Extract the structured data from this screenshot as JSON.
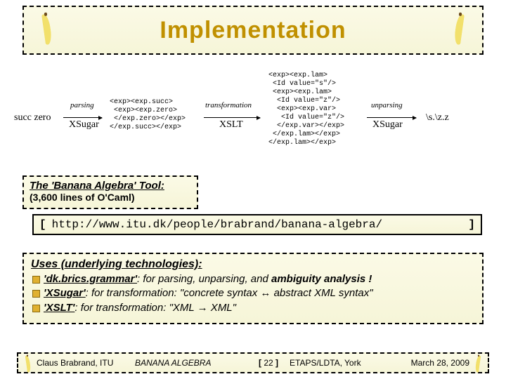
{
  "title": "Implementation",
  "diagram": {
    "source": "succ zero",
    "parsing": "parsing",
    "tool1": "XSugar",
    "xml1": "<exp><exp.succ>\n <exp><exp.zero>\n </exp.zero></exp>\n</exp.succ></exp>",
    "transformation": "transformation",
    "tool2": "XSLT",
    "xml2": "<exp><exp.lam>\n <Id value=\"s\"/>\n <exp><exp.lam>\n  <Id value=\"z\"/>\n  <exp><exp.var>\n   <Id value=\"z\"/>\n  </exp.var></exp>\n </exp.lam></exp>\n</exp.lam></exp>",
    "unparsing": "unparsing",
    "tool3": "XSugar",
    "result": "\\s.\\z.z"
  },
  "tool": {
    "heading": "The 'Banana Algebra' Tool:",
    "sub": "(3,600 lines of O'Caml)"
  },
  "url": {
    "open": "[",
    "close": "]",
    "href": "http://www.itu.dk/people/brabrand/banana-algebra/"
  },
  "uses": {
    "heading": "Uses (underlying technologies):",
    "items": [
      {
        "tech": "'dk.brics.grammar'",
        "desc": ": for parsing, unparsing, and ",
        "strong": "ambiguity analysis !"
      },
      {
        "tech": "'XSugar'",
        "desc": ": for transformation: \"concrete syntax ",
        "arrow": "↔",
        "after": " abstract XML syntax\""
      },
      {
        "tech": "'XSLT'",
        "desc": ": for transformation: \"XML ",
        "arrow": "→",
        "after": " XML\""
      }
    ]
  },
  "footer": {
    "author": "Claus Brabrand, ITU",
    "talk": "BANANA ALGEBRA",
    "page_open": "[",
    "page_num": "22",
    "page_close": "]",
    "venue": "ETAPS/LDTA, York",
    "date": "March 28, 2009"
  }
}
